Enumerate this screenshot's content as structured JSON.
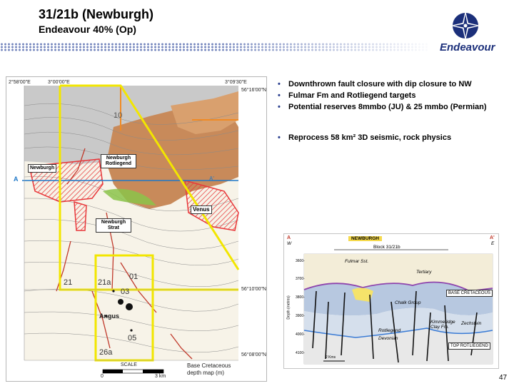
{
  "header": {
    "title": "31/21b (Newburgh)",
    "subtitle": "Endeavour 40% (Op)",
    "logo_text": "Endeavour"
  },
  "map": {
    "coords": {
      "lon1": "2°58'00\"E",
      "lon2": "3°00'00\"E",
      "lon3": "3°09'30\"E",
      "lat_top": "56°16'00\"N",
      "lat_mid": "56°10'00\"N",
      "lat_bottom": "56°08'00\"N"
    },
    "labels": {
      "newburgh": "Newburgh",
      "newburgh_rotliegend": "Newburgh Rotliegend",
      "venus": "Venus",
      "newburgh_strat": "Newburgh Strat",
      "angus": "Angus",
      "a_left": "A",
      "a_right": "A'"
    },
    "block_numbers": [
      "10",
      "21",
      "21a",
      "01",
      "03",
      "05",
      "26a"
    ],
    "scale_title": "SCALE",
    "scale_start": "0",
    "scale_end": "3 km",
    "caption": "Base Cretaceous depth map (m)"
  },
  "bullets": [
    "Downthrown fault closure with dip closure to NW",
    "Fulmar Fm and Rotliegend targets",
    "Potential reserves 8mmbo (JU) & 25 mmbo (Permian)",
    "Reprocess 58 km² 3D seismic, rock physics"
  ],
  "section": {
    "a_left": "A",
    "a_right": "A'",
    "w": "W",
    "e": "E",
    "tag": "NEWBURGH",
    "block": "Block 31/21b",
    "depth_label": "Depth (metres)",
    "depths": [
      "3600-",
      "3700-",
      "3800-",
      "3900-",
      "4000-",
      "4100-"
    ],
    "fulmar": "Fulmar Sst.",
    "tertiary": "Tertiary",
    "chalk": "Chalk Group",
    "base_cret": "BASE CRETACEOUS",
    "kimm": "Kimmeridge Clay Fm.",
    "zechstein": "Zechstein",
    "rotliegend": "Rotliegend",
    "devonian": "Devonian",
    "top_rot": "TOP ROTLIEGEND",
    "scale": "2 Kms"
  },
  "page_number": "47",
  "colors": {
    "title_blue": "#1b2f7a",
    "dot_blue": "#5a6fb0",
    "yellow_line": "#f2e600",
    "red_prospect": "#e8373a"
  }
}
